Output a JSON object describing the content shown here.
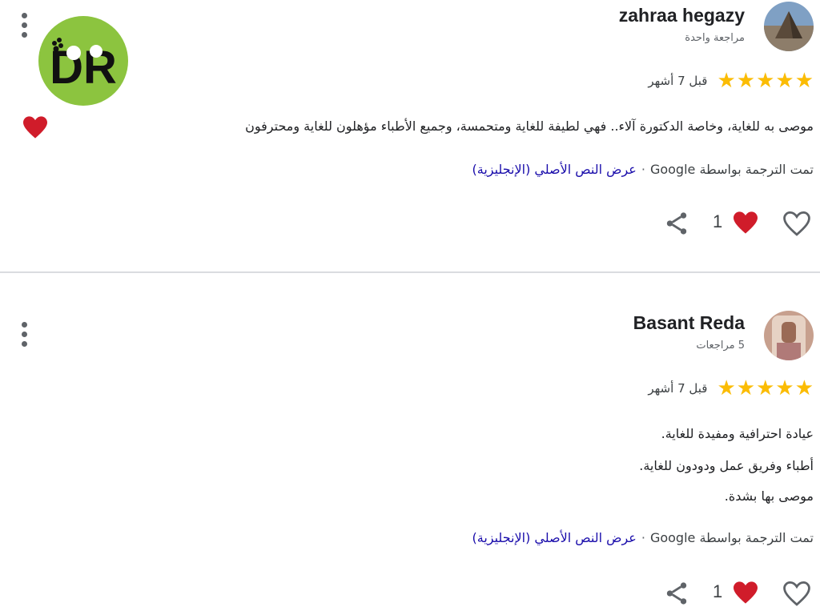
{
  "reviews": [
    {
      "author": "zahraa hegazy",
      "review_count": "مراجعة واحدة",
      "rating": 5,
      "date": "قبل 7 أشهر",
      "text_lines": [
        "موصى به للغاية، وخاصة الدكتورة آلاء.. فهي لطيفة للغاية ومتحمسة، وجميع الأطباء مؤهلون للغاية ومحترفون"
      ],
      "has_heart_emoji": true,
      "translated_by": "تمت الترجمة بواسطة Google",
      "separator": "·",
      "view_original": "عرض النص الأصلي (الإنجليزية)",
      "likes": "1"
    },
    {
      "author": "Basant Reda",
      "review_count": "5 مراجعات",
      "rating": 5,
      "date": "قبل 7 أشهر",
      "text_lines": [
        "عيادة احترافية ومفيدة للغاية.",
        "أطباء وفريق عمل ودودون للغاية.",
        "موصى بها بشدة."
      ],
      "translated_by": "تمت الترجمة بواسطة Google",
      "separator": "·",
      "view_original": "عرض النص الأصلي (الإنجليزية)",
      "likes": "1"
    }
  ],
  "logo": {
    "text": "DR",
    "bg_color": "#8cc43f"
  },
  "colors": {
    "star": "#fbbc04",
    "heart": "#d01c2a",
    "link": "#1a0dab",
    "divider": "#dadce0"
  },
  "icons": [
    "more-vert-icon",
    "share-icon",
    "heart-filled-icon",
    "heart-outline-icon",
    "star-icon"
  ]
}
